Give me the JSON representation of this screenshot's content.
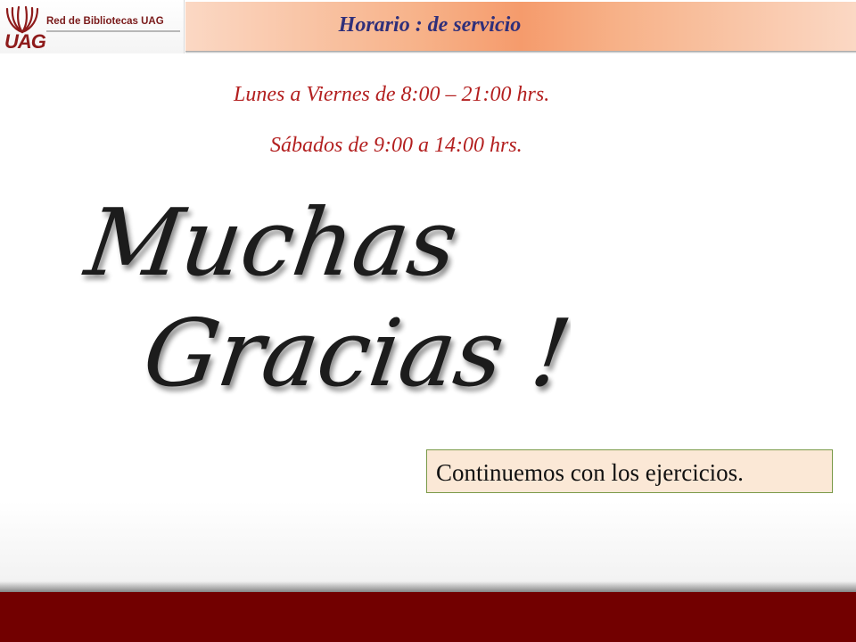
{
  "header": {
    "logo_text": "Red de Bibliotecas UAG",
    "logo_abbr": "UAG",
    "title": "Horario : de servicio"
  },
  "schedule": {
    "weekdays": "Lunes a Viernes de 8:00 – 21:00 hrs.",
    "saturday": "Sábados de 9:00 a 14:00 hrs."
  },
  "thanks": {
    "word1": "Muchas",
    "word2": "Gracias !"
  },
  "callout": {
    "text": "Continuemos con los ejercicios."
  },
  "colors": {
    "title": "#2f2f7a",
    "schedule": "#b31f1f",
    "footer": "#720000",
    "callout_bg": "#fbe8d6",
    "callout_border": "#7a9a49"
  }
}
